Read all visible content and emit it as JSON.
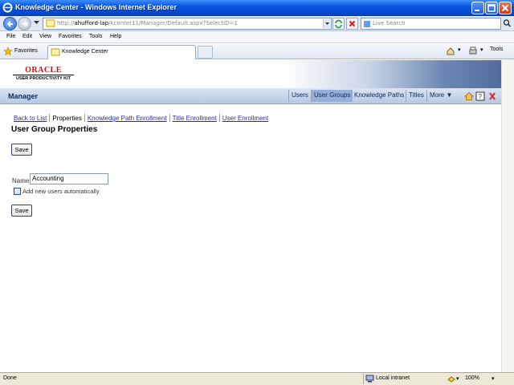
{
  "window": {
    "title": "Knowledge Center - Windows Internet Explorer"
  },
  "address_bar": {
    "url_prefix": "http://",
    "url_host": "ahufford-lap",
    "url_path": "/kcenter11/Manager/Default.aspx?SelectID=1",
    "search_placeholder": "Live Search"
  },
  "menu": [
    "File",
    "Edit",
    "View",
    "Favorites",
    "Tools",
    "Help"
  ],
  "favorites_bar": {
    "favorites_label": "Favorites",
    "tab_label": "Knowledge Center",
    "tools_label": "Tools"
  },
  "banner": {
    "logo_brand": "ORACLE",
    "logo_product": "USER PRODUCTIVITY KIT"
  },
  "manager_bar": {
    "title": "Manager",
    "nav": [
      "Users",
      "User Groups",
      "Knowledge Paths",
      "Titles",
      "More"
    ],
    "active": "User Groups"
  },
  "subnav": {
    "back": "Back to List",
    "current": "Properties",
    "links": [
      "Knowledge Path Enrollment",
      "Title Enrollment",
      "User Enrollment"
    ]
  },
  "form": {
    "heading": "User Group Properties",
    "save_label": "Save",
    "name_label": "Name",
    "name_value": "Accounting",
    "auto_add_label": "Add new users automatically",
    "auto_add_checked": false
  },
  "status_bar": {
    "status": "Done",
    "zone": "Local intranet",
    "zoom": "100%"
  }
}
